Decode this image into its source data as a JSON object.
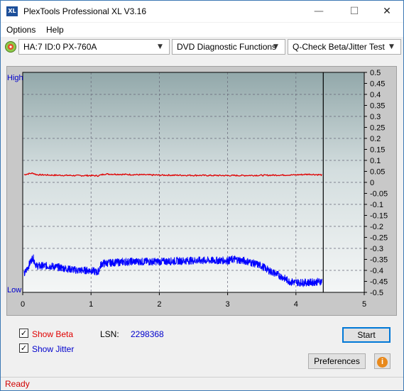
{
  "window": {
    "icon_text": "XL",
    "title": "PlexTools Professional XL V3.16",
    "minimize": "—",
    "maximize": "☐",
    "close": "✕"
  },
  "menu": {
    "items": [
      {
        "label": "Options"
      },
      {
        "label": "Help"
      }
    ]
  },
  "toolbar": {
    "drive": "HA:7 ID:0  PX-760A",
    "function": "DVD Diagnostic Functions",
    "test": "Q-Check Beta/Jitter Test"
  },
  "chart": {
    "high_label": "High",
    "low_label": "Low",
    "colors": {
      "beta": "#e00000",
      "jitter": "#0000ff",
      "cursor": "#000000"
    }
  },
  "chart_data": {
    "type": "line",
    "xlim": [
      0,
      5
    ],
    "x_ticks": [
      "0",
      "1",
      "2",
      "3",
      "4",
      "5"
    ],
    "ylim": [
      -0.5,
      0.5
    ],
    "y_ticks": [
      "0.5",
      "0.45",
      "0.4",
      "0.35",
      "0.3",
      "0.25",
      "0.2",
      "0.15",
      "0.1",
      "0.05",
      "0",
      "-0.05",
      "-0.1",
      "-0.15",
      "-0.2",
      "-0.25",
      "-0.3",
      "-0.35",
      "-0.4",
      "-0.45",
      "-0.5"
    ],
    "grid": true,
    "cursor_x": 4.4,
    "series": [
      {
        "name": "Beta",
        "color": "#e00000",
        "x": [
          0.02,
          0.1,
          0.15,
          0.2,
          0.4,
          0.6,
          0.8,
          1.0,
          1.1,
          1.2,
          1.5,
          2.0,
          2.5,
          3.0,
          3.5,
          4.0,
          4.2,
          4.38
        ],
        "y": [
          0.035,
          0.04,
          0.042,
          0.035,
          0.033,
          0.032,
          0.031,
          0.031,
          0.03,
          0.038,
          0.036,
          0.033,
          0.032,
          0.031,
          0.032,
          0.034,
          0.037,
          0.034
        ]
      },
      {
        "name": "Jitter",
        "color": "#0000ff",
        "x": [
          0.02,
          0.1,
          0.15,
          0.2,
          0.4,
          0.6,
          0.8,
          1.0,
          1.1,
          1.15,
          1.3,
          1.6,
          2.0,
          2.5,
          3.0,
          3.1,
          3.3,
          3.5,
          3.6,
          3.8,
          3.9,
          4.0,
          4.2,
          4.38
        ],
        "y": [
          -0.42,
          -0.37,
          -0.34,
          -0.38,
          -0.38,
          -0.39,
          -0.4,
          -0.4,
          -0.41,
          -0.37,
          -0.365,
          -0.36,
          -0.36,
          -0.355,
          -0.355,
          -0.35,
          -0.36,
          -0.38,
          -0.4,
          -0.43,
          -0.45,
          -0.455,
          -0.455,
          -0.45
        ]
      }
    ]
  },
  "options": {
    "show_beta_label": "Show Beta",
    "show_jitter_label": "Show Jitter",
    "checkmark": "✓",
    "lsn_label": "LSN:",
    "lsn_value": "2298368"
  },
  "buttons": {
    "start": "Start",
    "preferences": "Preferences",
    "info": "i"
  },
  "status": {
    "text": "Ready"
  }
}
